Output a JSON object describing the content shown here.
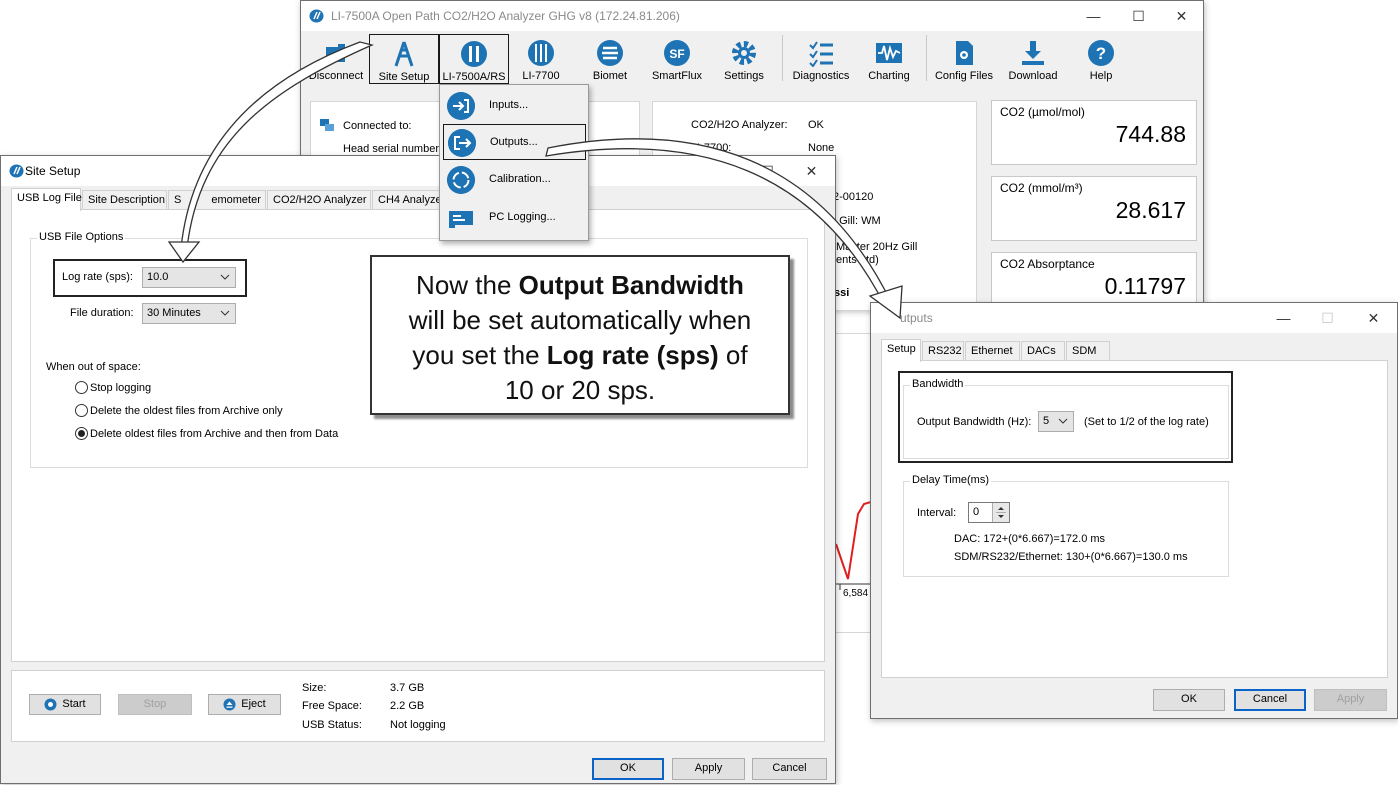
{
  "main_window": {
    "title": "LI-7500A Open Path CO2/H2O Analyzer GHG v8 (172.24.81.206)",
    "toolbar": [
      {
        "label": "Disconnect",
        "icon": "disconnect-icon"
      },
      {
        "label": "Site Setup",
        "icon": "tower-icon"
      },
      {
        "label": "LI-7500A/RS",
        "icon": "analyzer-icon"
      },
      {
        "label": "LI-7700",
        "icon": "methane-analyzer-icon"
      },
      {
        "label": "Biomet",
        "icon": "biomet-icon"
      },
      {
        "label": "SmartFlux",
        "icon": "smartflux-icon",
        "glyph": "SF"
      },
      {
        "label": "Settings",
        "icon": "gear-icon"
      },
      {
        "label": "Diagnostics",
        "icon": "checklist-icon"
      },
      {
        "label": "Charting",
        "icon": "waveform-icon"
      },
      {
        "label": "Config Files",
        "icon": "config-file-icon"
      },
      {
        "label": "Download",
        "icon": "download-icon"
      },
      {
        "label": "Help",
        "icon": "help-icon",
        "glyph": "?"
      }
    ],
    "connection": {
      "connected_to_label": "Connected to:",
      "head_serial_label": "Head serial number:"
    },
    "status": {
      "co2h2o_label": "CO2/H2O Analyzer:",
      "co2h2o_value": "OK",
      "li7700_label": "LI-7700:",
      "li7700_value": "None",
      "serial_fragment": "2-00120",
      "anemometer_fragment_a": ":  Gill:  WM",
      "anemometer_fragment_b": "Master 20Hz Gill",
      "anemometer_fragment_c": "ents Ltd)",
      "bold_fragment": "ssi"
    },
    "chart_tick": "6,584",
    "readouts": [
      {
        "label": "CO2 (µmol/mol)",
        "value": "744.88"
      },
      {
        "label": "CO2 (mmol/m³)",
        "value": "28.617"
      },
      {
        "label": "CO2 Absorptance",
        "value": "0.11797"
      }
    ]
  },
  "analyzer_menu": {
    "items": [
      {
        "label": "Inputs...",
        "icon": "input-icon"
      },
      {
        "label": "Outputs...",
        "icon": "output-icon"
      },
      {
        "label": "Calibration...",
        "icon": "calibration-icon"
      },
      {
        "label": "PC Logging...",
        "icon": "pc-logging-icon"
      }
    ]
  },
  "site_setup": {
    "title": "Site Setup",
    "tabs": [
      "USB Log File",
      "Site Description",
      "S",
      "emometer",
      "CO2/H2O Analyzer",
      "CH4 Analyzer"
    ],
    "group_title": "USB File Options",
    "log_rate_label": "Log rate (sps):",
    "log_rate_value": "10.0",
    "file_duration_label": "File duration:",
    "file_duration_value": "30 Minutes",
    "out_of_space_label": "When out of space:",
    "options": [
      "Stop logging",
      "Delete the oldest files from Archive only",
      "Delete oldest files from Archive and then from Data"
    ],
    "selected_option": 2,
    "buttons": {
      "start": "Start",
      "stop": "Stop",
      "eject": "Eject"
    },
    "usb_info": [
      {
        "label": "Size:",
        "value": "3.7 GB"
      },
      {
        "label": "Free Space:",
        "value": "2.2 GB"
      },
      {
        "label": "USB Status:",
        "value": "Not logging"
      }
    ],
    "dialog_buttons": {
      "ok": "OK",
      "apply": "Apply",
      "cancel": "Cancel"
    }
  },
  "callout": {
    "line1_pre": "Now the ",
    "line1_bold": "Output Bandwidth",
    "line2": "will be set automatically when",
    "line3_pre": "you set the ",
    "line3_bold": "Log rate (sps)",
    "line3_post": " of",
    "line4": "10 or 20 sps."
  },
  "outputs": {
    "title": "Outputs",
    "title_visible": "utputs",
    "tabs": [
      "Setup",
      "RS232",
      "Ethernet",
      "DACs",
      "SDM"
    ],
    "bandwidth_group": "Bandwidth",
    "bandwidth_label": "Output Bandwidth (Hz):",
    "bandwidth_value": "5",
    "bandwidth_note": "(Set to 1/2 of the log rate)",
    "delay_group": "Delay Time(ms)",
    "interval_label": "Interval:",
    "interval_value": "0",
    "dac_text": "DAC: 172+(0*6.667)=172.0 ms",
    "sdm_text": "SDM/RS232/Ethernet: 130+(0*6.667)=130.0 ms",
    "buttons": {
      "ok": "OK",
      "cancel": "Cancel",
      "apply": "Apply"
    }
  },
  "colors": {
    "accent": "#1e73b4",
    "chart_line": "#e02020",
    "default_button_border": "#0a64c8"
  }
}
